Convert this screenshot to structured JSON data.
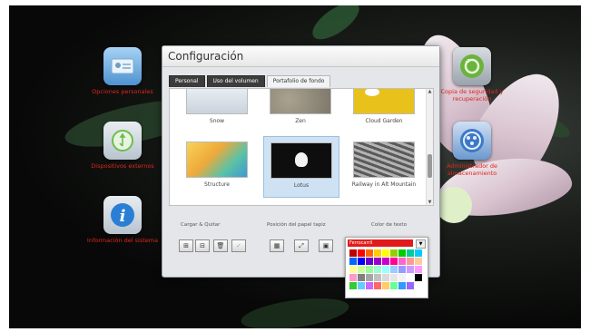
{
  "window": {
    "title": "Configuración",
    "tabs": [
      "Personal",
      "Uso del volumen",
      "Portafolio de fondo"
    ],
    "active_tab": 2
  },
  "desktop_icons_left": [
    {
      "label": "Opciones personales",
      "icon": "id-card-icon"
    },
    {
      "label": "Dispositivos externos",
      "icon": "usb-icon"
    },
    {
      "label": "Información del sistema",
      "icon": "info-icon"
    }
  ],
  "desktop_icons_right": [
    {
      "label": "Copia de seguridad y recuperación",
      "icon": "restore-icon"
    },
    {
      "label": "Administrador de almacenamiento",
      "icon": "storage-icon"
    }
  ],
  "wallpapers": [
    {
      "name": "Snow",
      "color": "#dfe6ee"
    },
    {
      "name": "Zen",
      "color": "#8f8a7e"
    },
    {
      "name": "Cloud Garden",
      "color": "#e8c21a"
    },
    {
      "name": "Structure",
      "color": "#f0c33a"
    },
    {
      "name": "Lotus",
      "color": "#111111"
    },
    {
      "name": "Railway in Alt Mountain",
      "color": "#8a8a8a"
    }
  ],
  "selected_wallpaper": "Lotus",
  "sections": {
    "upload_label": "Cargar & Quitar",
    "position_label": "Posición del papel tapiz",
    "text_color_label": "Color de texto"
  },
  "color_picker": {
    "selected_name": "Ferrocarril",
    "selected_color": "#e11b1b",
    "swatches": [
      "#c00000",
      "#ff0000",
      "#ff6600",
      "#ffcc00",
      "#ffff00",
      "#99cc00",
      "#00cc00",
      "#00cc99",
      "#00ccff",
      "#0066ff",
      "#0000ff",
      "#6600cc",
      "#9900cc",
      "#cc00cc",
      "#ff0099",
      "#ff66cc",
      "#ff9999",
      "#ffcc99",
      "#ffff99",
      "#ccff99",
      "#99ff99",
      "#99ffcc",
      "#99ffff",
      "#99ccff",
      "#9999ff",
      "#cc99ff",
      "#ff99ff",
      "#ff99cc",
      "#808080",
      "#a6a6a6",
      "#c0c0c0",
      "#d9d9d9",
      "#e6e6e6",
      "#f2f2f2",
      "#ffffff",
      "#000000",
      "#33cc33",
      "#66ccff",
      "#cc66ff",
      "#ff6666",
      "#ffcc66",
      "#66ff99",
      "#3399ff",
      "#9966ff",
      "#ffffff"
    ]
  }
}
